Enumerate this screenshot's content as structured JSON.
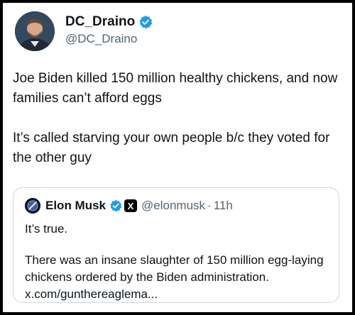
{
  "colors": {
    "verified_badge": "#1d9bf0",
    "primary_text": "#0f1419",
    "secondary_text": "#536471",
    "border": "#cfd9de"
  },
  "post": {
    "author": {
      "name": "DC_Draino",
      "handle": "@DC_Draino",
      "verified": true,
      "avatar_icon": "user-photo-avatar"
    },
    "text_lines": [
      "Joe Biden killed 150 million healthy chickens, and now families can’t afford eggs",
      "It’s called starving your own people b/c they voted for the other guy"
    ]
  },
  "quoted_post": {
    "author": {
      "name": "Elon Musk",
      "handle": "@elonmusk",
      "verified": true,
      "affiliate_badge": "X",
      "avatar_icon": "user-photo-avatar"
    },
    "separator": "·",
    "time": "11h",
    "text_lines": [
      "It’s true.",
      "There was an insane slaughter of 150 million egg-laying chickens ordered by the Biden administration.",
      "x.com/gunthereaglema..."
    ]
  }
}
